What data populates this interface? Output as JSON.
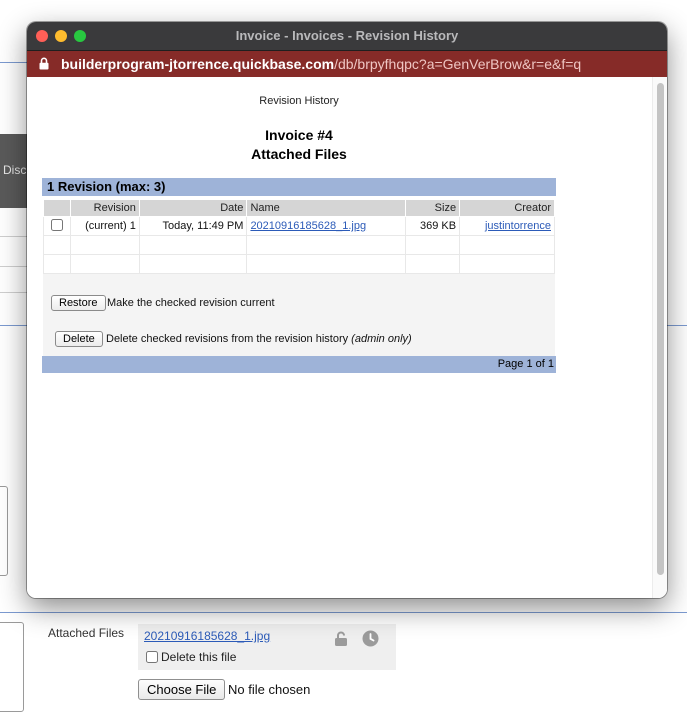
{
  "background": {
    "side_tab_label": "Disc",
    "attached_files": {
      "label": "Attached Files",
      "file_link": "20210916185628_1.jpg",
      "delete_label": "Delete this file",
      "choose_button": "Choose File",
      "no_file_text": "No file chosen"
    },
    "icons": [
      "lock-icon",
      "clock-icon"
    ]
  },
  "window": {
    "title": "Invoice - Invoices - Revision History",
    "url_domain": "builderprogram-jtorrence.quickbase.com",
    "url_path": "/db/brpyfhqpc?a=GenVerBrow&r=e&f=q"
  },
  "page": {
    "heading_small": "Revision History",
    "invoice_title": "Invoice #4",
    "invoice_subtitle": "Attached Files",
    "panel_title": "1 Revision (max: 3)",
    "columns": [
      "Revision",
      "Date",
      "Name",
      "Size",
      "Creator"
    ],
    "rows": [
      {
        "revision": "(current) 1",
        "date": "Today, 11:49 PM",
        "name": "20210916185628_1.jpg",
        "size": "369 KB",
        "creator": "justintorrence"
      }
    ],
    "restore_button": "Restore",
    "restore_text": "Make the checked revision current",
    "delete_button": "Delete",
    "delete_text": "Delete checked revisions from the revision history",
    "delete_note": "(admin only)",
    "page_info": "Page 1 of 1"
  },
  "colors": {
    "url_bar": "#862b28",
    "panel_header": "#9eb3d8",
    "link": "#2c5bb8",
    "titlebar": "#3a3a3c"
  }
}
